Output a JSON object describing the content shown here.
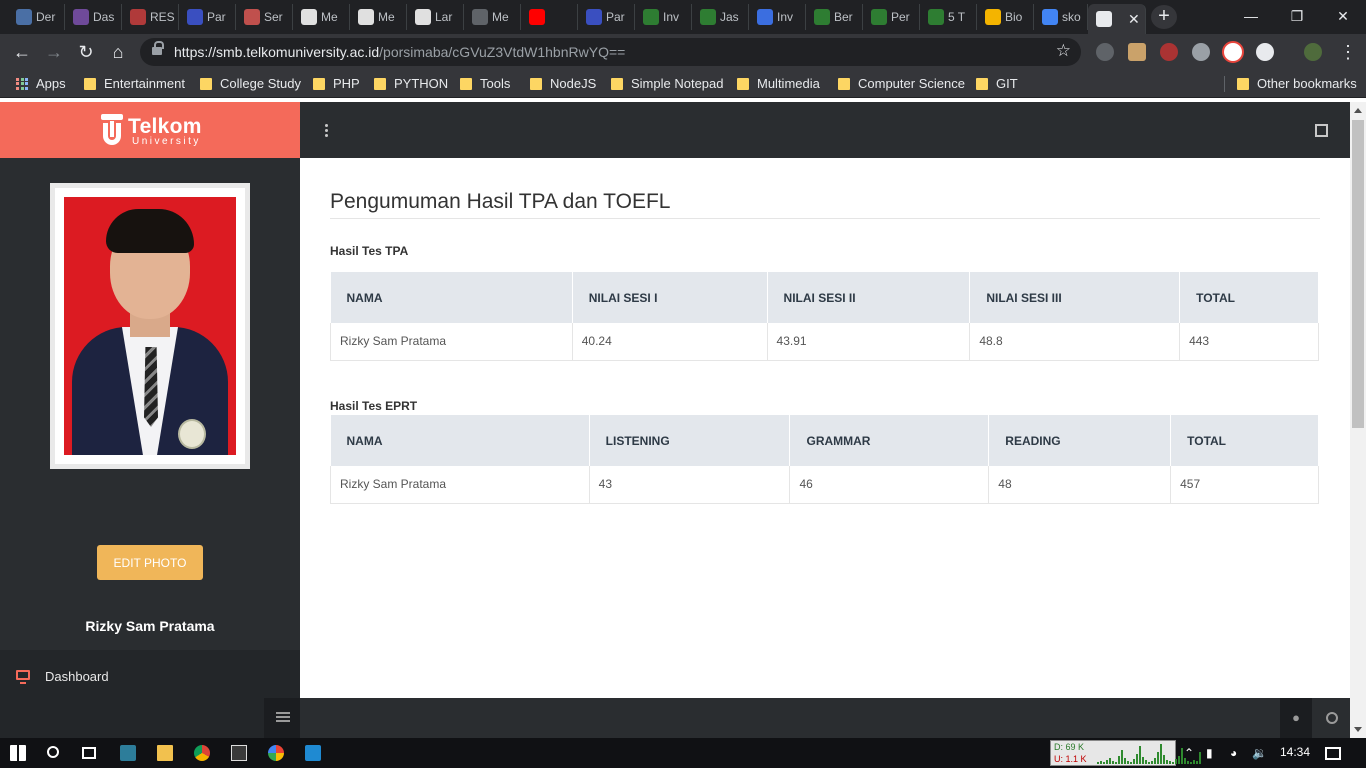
{
  "browser": {
    "tabs": [
      {
        "label": "Der",
        "color": "#4a6fa5"
      },
      {
        "label": "Das",
        "color": "#6f4a9a"
      },
      {
        "label": "RES",
        "color": "#b03a3a"
      },
      {
        "label": "Par",
        "color": "#3a4fc0"
      },
      {
        "label": "Ser",
        "color": "#c0504d"
      },
      {
        "label": "Me",
        "color": "#e0e0e0"
      },
      {
        "label": "Me",
        "color": "#e0e0e0"
      },
      {
        "label": "Lar",
        "color": "#e0e0e0"
      },
      {
        "label": "Me",
        "color": "#5f6368"
      },
      {
        "label": "",
        "color": "#ff0000"
      },
      {
        "label": "Par",
        "color": "#3a4fc0"
      },
      {
        "label": "Inv",
        "color": "#2e7d32"
      },
      {
        "label": "Jas",
        "color": "#2e7d32"
      },
      {
        "label": "Inv",
        "color": "#3b6ee0"
      },
      {
        "label": "Ber",
        "color": "#2e7d32"
      },
      {
        "label": "Per",
        "color": "#2e7d32"
      },
      {
        "label": "5 T",
        "color": "#2e7d32"
      },
      {
        "label": "Bio",
        "color": "#f4b400"
      },
      {
        "label": "sko",
        "color": "#4285f4"
      },
      {
        "label": "",
        "color": "#e8eaed"
      }
    ],
    "url_host": "https://smb.telkomuniversity.ac.id",
    "url_path": "/porsimaba/cGVuZ3VtdW1hbnRwYQ==",
    "bookmarks": [
      {
        "label": "Apps",
        "icon": "apps-grid-icon"
      },
      {
        "label": "Entertainment",
        "icon": "folder-icon"
      },
      {
        "label": "College Study",
        "icon": "folder-icon"
      },
      {
        "label": "PHP",
        "icon": "folder-icon"
      },
      {
        "label": "PYTHON",
        "icon": "folder-icon"
      },
      {
        "label": "Tools",
        "icon": "folder-icon"
      },
      {
        "label": "NodeJS",
        "icon": "folder-icon"
      },
      {
        "label": "Simple Notepad",
        "icon": "folder-icon"
      },
      {
        "label": "Multimedia",
        "icon": "folder-icon"
      },
      {
        "label": "Computer Science",
        "icon": "folder-icon"
      },
      {
        "label": "GIT",
        "icon": "folder-icon"
      }
    ],
    "other_bookmarks": "Other bookmarks"
  },
  "app": {
    "brand_name": "Telkom",
    "brand_sub": "University",
    "brand_color": "#f46a5a",
    "edit_photo": "EDIT PHOTO",
    "profile_name": "Rizky Sam Pratama",
    "nav_dashboard": "Dashboard"
  },
  "page": {
    "title": "Pengumuman Hasil TPA dan TOEFL",
    "tpa": {
      "heading": "Hasil Tes TPA",
      "columns": [
        "NAMA",
        "NILAI SESI I",
        "NILAI SESI II",
        "NILAI SESI III",
        "TOTAL"
      ],
      "rows": [
        [
          "Rizky Sam Pratama",
          "40.24",
          "43.91",
          "48.8",
          "443"
        ]
      ]
    },
    "eprt": {
      "heading": "Hasil Tes EPRT",
      "columns": [
        "NAMA",
        "LISTENING",
        "GRAMMAR",
        "READING",
        "TOTAL"
      ],
      "rows": [
        [
          "Rizky Sam Pratama",
          "43",
          "46",
          "48",
          "457"
        ]
      ]
    }
  },
  "taskbar": {
    "net_down": "D: 69 K",
    "net_up": "U: 1.1 K",
    "time": "14:34"
  }
}
